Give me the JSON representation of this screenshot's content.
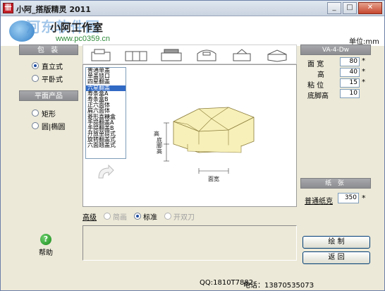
{
  "window": {
    "title": "小阿_搭版精灵 2011",
    "icon_glyph": "卌",
    "buttons": {
      "minimize": "_",
      "maximize": "□",
      "close": "✕"
    }
  },
  "banner": {
    "brand": "小阿工作室",
    "watermark_title": "河东软件园",
    "watermark_url": "www.pc0359.cn"
  },
  "unit_label": "单位:mm",
  "left_panel": {
    "packaging": {
      "heading": "包 装",
      "options": [
        {
          "label": "直立式",
          "selected": true
        },
        {
          "label": "平卧式",
          "selected": false
        }
      ]
    },
    "flat_products": {
      "heading": "平面产品",
      "options": [
        {
          "label": "矩形",
          "selected": false
        },
        {
          "label": "圆|椭圆",
          "selected": false
        }
      ]
    }
  },
  "shape_thumbnails": [
    "box-thumb-1",
    "box-thumb-2",
    "box-thumb-3",
    "box-thumb-4",
    "box-thumb-5",
    "box-thumb-6"
  ],
  "box_list": {
    "items": [
      "普通单盖",
      "单盖锁口",
      "四星翻盖",
      "六星翻盖",
      "寿条盒A",
      "寿条盒B",
      "正六面体",
      "扁六面体",
      "菱形喜糖盒",
      "手提翻盖A",
      "手提翻盖B",
      "开放单提式",
      "旋转翻盖式",
      "六面翘盖式"
    ],
    "selected_index": 3
  },
  "diagram": {
    "height_label": "高",
    "base_label": "底脚高",
    "width_label": "面宽"
  },
  "spec": {
    "code": "VA-4-Dw",
    "fields": [
      {
        "label": "面 宽",
        "value": "80",
        "required": "*"
      },
      {
        "label": "高",
        "value": "40",
        "required": "*"
      },
      {
        "label": "粘 位",
        "value": "15",
        "required": "*"
      },
      {
        "label": "底脚高",
        "value": "10",
        "required": ""
      }
    ]
  },
  "paper": {
    "heading": "纸 张",
    "label": "普通纸克",
    "value": "350",
    "required": "*"
  },
  "help_label": "帮助",
  "quality": {
    "label": "高级",
    "options": [
      {
        "label": "简画",
        "selected": false,
        "disabled": true
      },
      {
        "label": "标准",
        "selected": true,
        "disabled": false
      },
      {
        "label": "开双刀",
        "selected": false,
        "disabled": true
      }
    ]
  },
  "actions": {
    "draw": "绘 制",
    "back": "返 回"
  },
  "footer": {
    "qq": "QQ:1810T7882",
    "tel": "电话：1387053507З"
  },
  "colors": {
    "list_selected": "#316ac5",
    "box_fill": "#f7f0b8",
    "box_stroke": "#8a7b3a"
  }
}
